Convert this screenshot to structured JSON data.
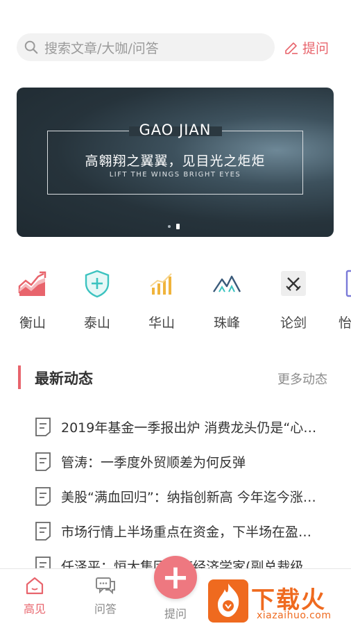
{
  "search": {
    "placeholder": "搜索文章/大咖/问答"
  },
  "header": {
    "ask_label": "提问"
  },
  "banner": {
    "title": "GAO JIAN",
    "subtitle": "高翱翔之翼翼，见目光之炬炬",
    "english": "LIFT THE WINGS  BRIGHT EYES",
    "dots": 2,
    "active_dot": 2
  },
  "categories": [
    {
      "label": "衡山",
      "icon": "chart-rise-icon",
      "color": "#e8646c"
    },
    {
      "label": "泰山",
      "icon": "shield-plus-icon",
      "color": "#3cc3c0"
    },
    {
      "label": "华山",
      "icon": "bar-chart-icon",
      "color": "#f0b43c"
    },
    {
      "label": "珠峰",
      "icon": "mountain-icon",
      "color": "#3a5a7a"
    },
    {
      "label": "论剑",
      "icon": "crossed-swords-icon",
      "color": "#333333"
    },
    {
      "label": "怡",
      "icon": "document-icon",
      "color": "#7a7ad8"
    }
  ],
  "section": {
    "title": "最新动态",
    "more": "更多动态"
  },
  "news": [
    "2019年基金一季报出炉 消费龙头仍是“心…",
    "管涛：一季度外贸顺差为何反弹",
    "美股“满血回归”：纳指创新高 今年迄今涨…",
    "市场行情上半场重点在资金，下半场在盈…",
    "任泽平：恒大集团首席经济学家(副总裁级"
  ],
  "tabs": [
    {
      "label": "高见",
      "active": true
    },
    {
      "label": "问答",
      "active": false
    },
    {
      "label": "提问",
      "active": false
    }
  ],
  "watermark": {
    "text": "下载火",
    "site": "xiazaihuo.com"
  },
  "colors": {
    "accent": "#e8646c",
    "inactive": "#888888"
  }
}
